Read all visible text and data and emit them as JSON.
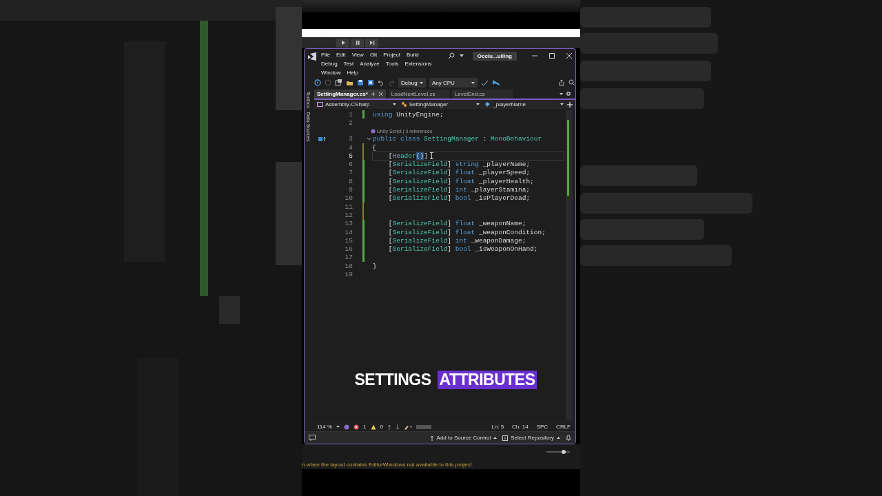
{
  "unity_toolbar": {
    "buttons": [
      {
        "kind": "play"
      },
      {
        "kind": "pause"
      },
      {
        "kind": "step"
      }
    ]
  },
  "window": {
    "menu": [
      [
        "File",
        "Edit",
        "View",
        "Git",
        "Project",
        "Build"
      ],
      [
        "Debug",
        "Test",
        "Analyze",
        "Tools",
        "Extensions"
      ],
      [
        "Window",
        "Help"
      ]
    ],
    "title": "Occlu...ulling",
    "toolbar": {
      "configuration": "Debug",
      "platform": "Any CPU"
    },
    "side_tabs": [
      "Toolbox",
      "Data Sources"
    ],
    "tabs": [
      {
        "label": "SettingManager.cs*",
        "selected": true
      },
      {
        "label": "LoadNextLevel.cs",
        "selected": false
      },
      {
        "label": "LevelEnd.cs",
        "selected": false
      }
    ],
    "nav": [
      "Assembly-CSharp",
      "SettingManager",
      "_playerName"
    ],
    "editor": {
      "lines": [
        {
          "number": "1",
          "changed": true,
          "saved": true,
          "current": false,
          "folds": false,
          "tokens": [
            {
              "kind": "keyword",
              "text": "using"
            },
            {
              "kind": "plain",
              "text": " UnityEngine;"
            }
          ]
        },
        {
          "number": "2",
          "changed": false,
          "current": false,
          "folds": false
        },
        {
          "number": "3",
          "changed": false,
          "current": false,
          "folds": true,
          "codelens": "Unity Script | 0 references",
          "tokens": [
            {
              "kind": "keyword",
              "text": "public class"
            },
            {
              "kind": "type",
              "text": " SettingManager"
            },
            {
              "kind": "plain",
              "text": " : "
            },
            {
              "kind": "type",
              "text": "MonoBehaviour"
            }
          ]
        },
        {
          "number": "4",
          "changed": true,
          "saved": false,
          "current": false,
          "folds": false,
          "tokens": [
            {
              "kind": "plain",
              "text": "{"
            }
          ]
        },
        {
          "number": "5",
          "changed": true,
          "saved": false,
          "current": true,
          "folds": false,
          "tokens": [
            {
              "kind": "plain",
              "text": "    ["
            },
            {
              "kind": "type",
              "text": "Header"
            },
            {
              "kind": "match",
              "text": "()"
            },
            {
              "kind": "plain",
              "text": "]"
            }
          ]
        },
        {
          "number": "6",
          "changed": true,
          "saved": true,
          "current": false,
          "folds": false,
          "tokens": [
            {
              "kind": "plain",
              "text": "    ["
            },
            {
              "kind": "type",
              "text": "SerializeField"
            },
            {
              "kind": "plain",
              "text": "] "
            },
            {
              "kind": "keyword",
              "text": "string"
            },
            {
              "kind": "plain",
              "text": " _playerName;"
            }
          ]
        },
        {
          "number": "7",
          "changed": true,
          "saved": true,
          "current": false,
          "folds": false,
          "tokens": [
            {
              "kind": "plain",
              "text": "    ["
            },
            {
              "kind": "type",
              "text": "SerializeField"
            },
            {
              "kind": "plain",
              "text": "] "
            },
            {
              "kind": "keyword",
              "text": "float"
            },
            {
              "kind": "plain",
              "text": " _playerSpeed;"
            }
          ]
        },
        {
          "number": "8",
          "changed": true,
          "saved": true,
          "current": false,
          "folds": false,
          "tokens": [
            {
              "kind": "plain",
              "text": "    ["
            },
            {
              "kind": "type",
              "text": "SerializeField"
            },
            {
              "kind": "plain",
              "text": "] "
            },
            {
              "kind": "keyword",
              "text": "float"
            },
            {
              "kind": "plain",
              "text": " _playerHealth;"
            }
          ]
        },
        {
          "number": "9",
          "changed": true,
          "saved": true,
          "current": false,
          "folds": false,
          "tokens": [
            {
              "kind": "plain",
              "text": "    ["
            },
            {
              "kind": "type",
              "text": "SerializeField"
            },
            {
              "kind": "plain",
              "text": "] "
            },
            {
              "kind": "keyword",
              "text": "int"
            },
            {
              "kind": "plain",
              "text": " _playerStamina;"
            }
          ]
        },
        {
          "number": "10",
          "changed": true,
          "saved": true,
          "current": false,
          "folds": false,
          "tokens": [
            {
              "kind": "plain",
              "text": "    ["
            },
            {
              "kind": "type",
              "text": "SerializeField"
            },
            {
              "kind": "plain",
              "text": "] "
            },
            {
              "kind": "keyword",
              "text": "bool"
            },
            {
              "kind": "plain",
              "text": " _isPlayerDead;"
            }
          ]
        },
        {
          "number": "11",
          "changed": true,
          "saved": false,
          "current": false,
          "folds": false
        },
        {
          "number": "12",
          "changed": true,
          "saved": false,
          "current": false,
          "folds": false
        },
        {
          "number": "13",
          "changed": true,
          "saved": true,
          "current": false,
          "folds": false,
          "tokens": [
            {
              "kind": "plain",
              "text": "    ["
            },
            {
              "kind": "type",
              "text": "SerializeField"
            },
            {
              "kind": "plain",
              "text": "] "
            },
            {
              "kind": "keyword",
              "text": "float"
            },
            {
              "kind": "plain",
              "text": " _weaponName;"
            }
          ]
        },
        {
          "number": "14",
          "changed": true,
          "saved": true,
          "current": false,
          "folds": false,
          "tokens": [
            {
              "kind": "plain",
              "text": "    ["
            },
            {
              "kind": "type",
              "text": "SerializeField"
            },
            {
              "kind": "plain",
              "text": "] "
            },
            {
              "kind": "keyword",
              "text": "float"
            },
            {
              "kind": "plain",
              "text": " _weaponCondition;"
            }
          ]
        },
        {
          "number": "15",
          "changed": true,
          "saved": true,
          "current": false,
          "folds": false,
          "tokens": [
            {
              "kind": "plain",
              "text": "    ["
            },
            {
              "kind": "type",
              "text": "SerializeField"
            },
            {
              "kind": "plain",
              "text": "] "
            },
            {
              "kind": "keyword",
              "text": "int"
            },
            {
              "kind": "plain",
              "text": " _weaponDamage;"
            }
          ]
        },
        {
          "number": "16",
          "changed": true,
          "saved": true,
          "current": false,
          "folds": false,
          "tokens": [
            {
              "kind": "plain",
              "text": "    ["
            },
            {
              "kind": "type",
              "text": "SerializeField"
            },
            {
              "kind": "plain",
              "text": "] "
            },
            {
              "kind": "keyword",
              "text": "bool"
            },
            {
              "kind": "plain",
              "text": " _isWeaponOnHand;"
            }
          ]
        },
        {
          "number": "17",
          "changed": true,
          "saved": true,
          "current": false,
          "folds": false
        },
        {
          "number": "18",
          "changed": false,
          "current": false,
          "folds": false,
          "tokens": [
            {
              "kind": "plain",
              "text": "}"
            }
          ]
        },
        {
          "number": "19",
          "changed": false,
          "current": false,
          "folds": false
        }
      ]
    },
    "caption": [
      {
        "text": "SETTINGS",
        "highlighted": false
      },
      {
        "text": "ATTRIBUTES",
        "highlighted": true
      }
    ],
    "status_bar": {
      "zoom": "114 %",
      "errors": "1",
      "warnings": "0",
      "line": "Ln: 5",
      "column": "Ch: 14",
      "spacing": "SPC",
      "line_ending": "CRLF"
    },
    "bottom_bar": {
      "source_control": "Add to Source Control",
      "repository": "Select Repository"
    }
  },
  "scale_slider": {
    "level": 0.8
  },
  "unity_message": "n when the layout contains EditorWindows not available in this project."
}
